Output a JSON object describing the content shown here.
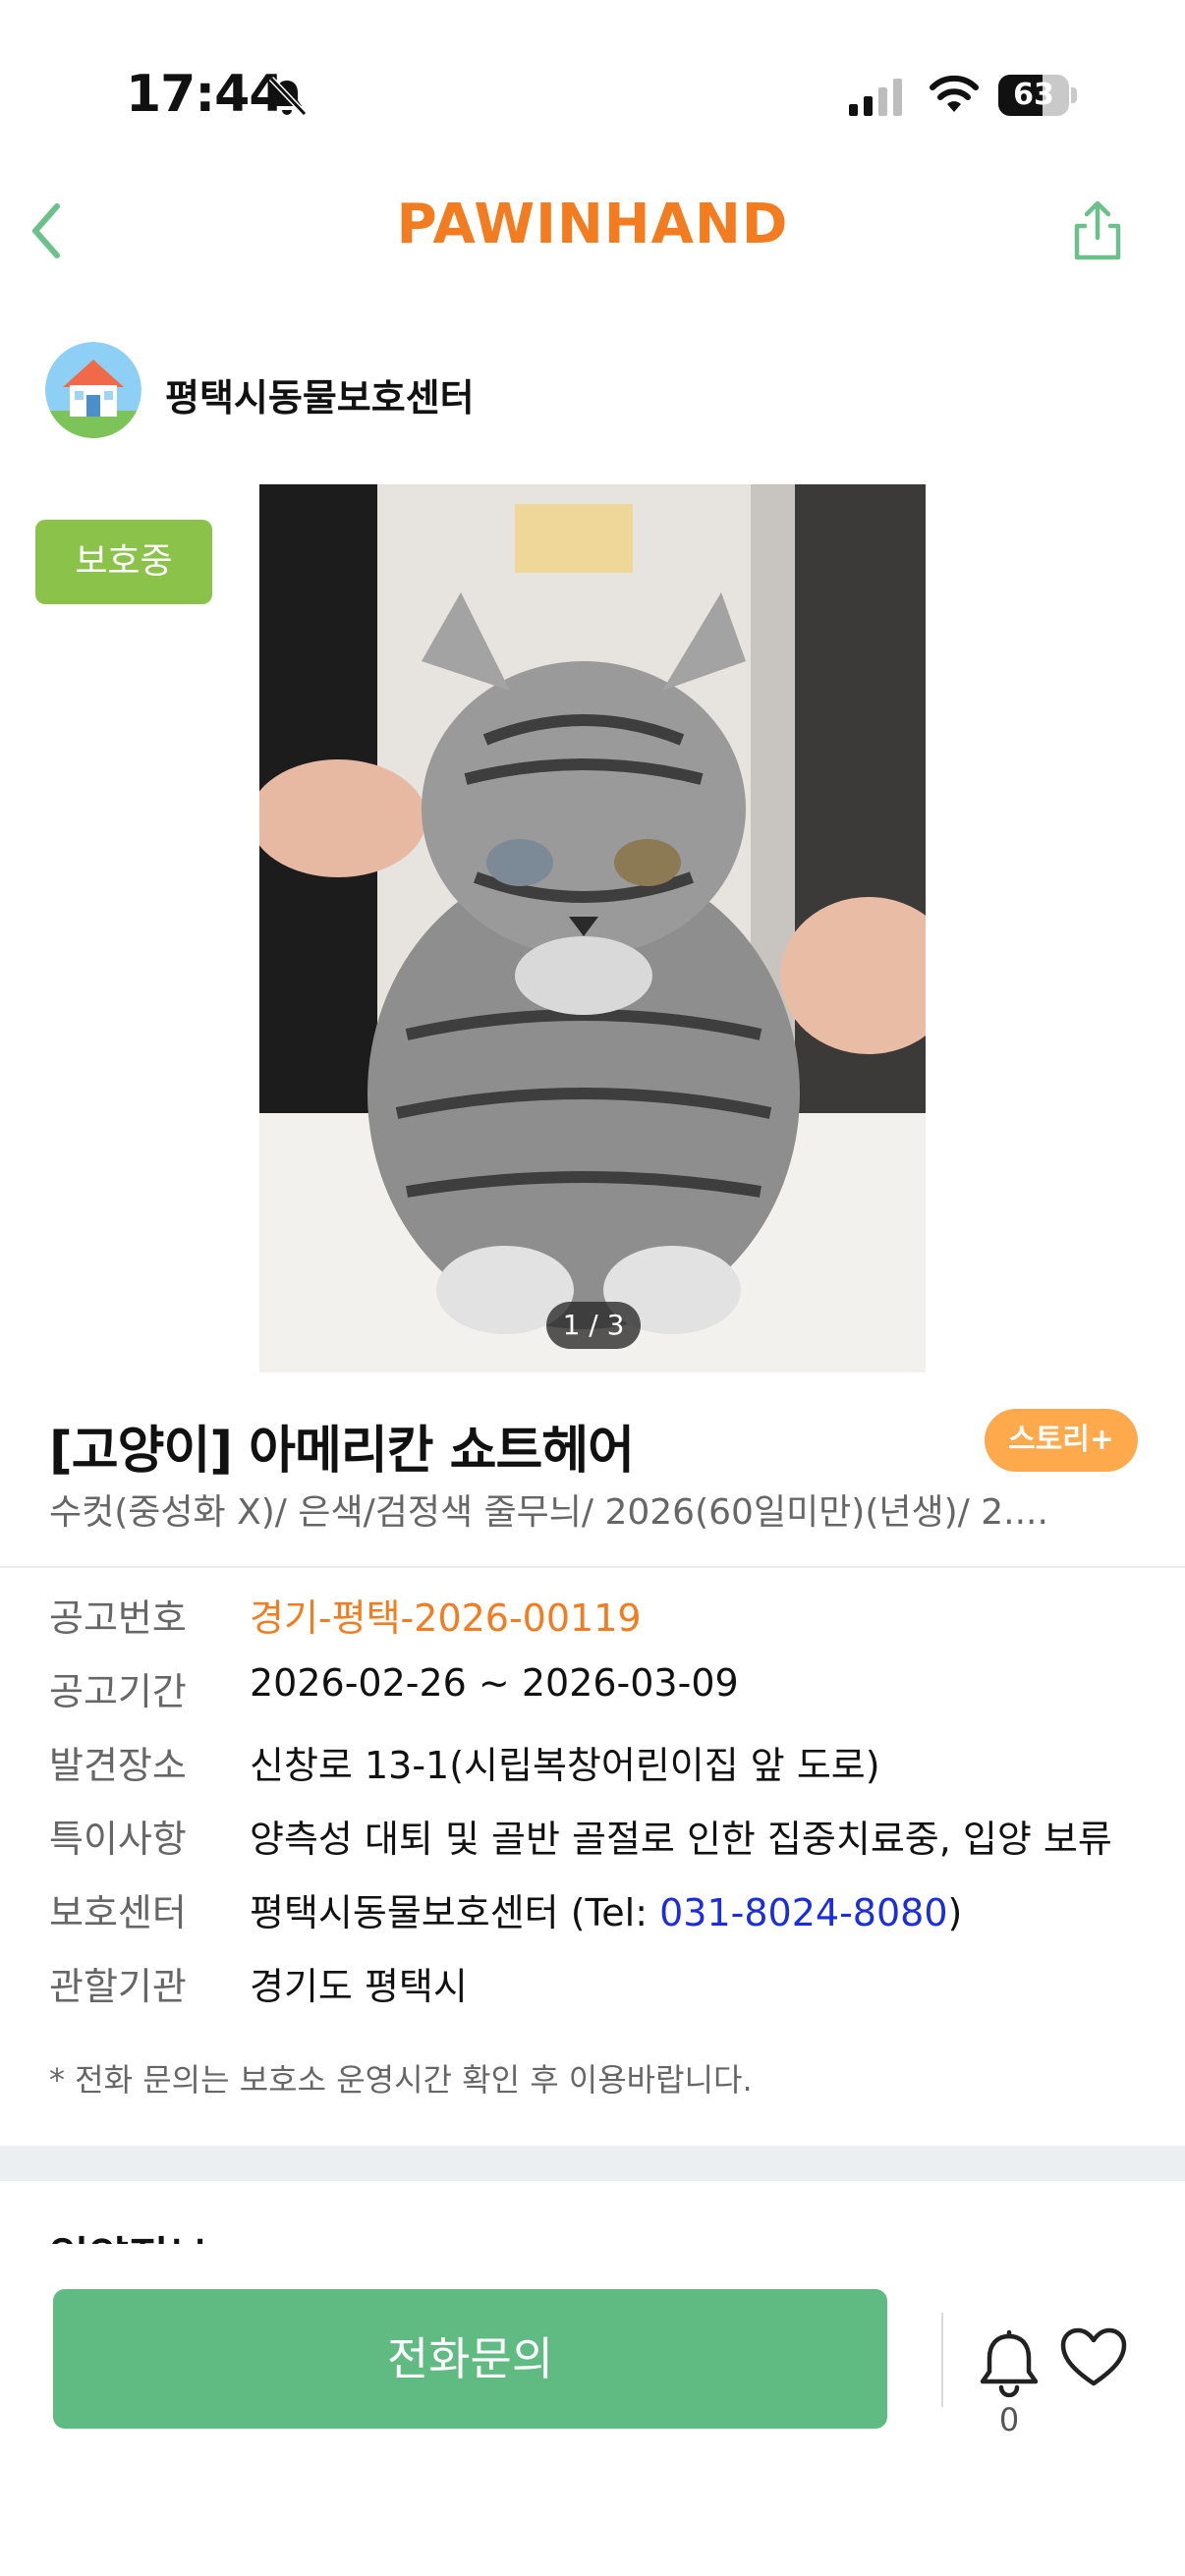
{
  "status_bar": {
    "time": "17:44",
    "battery": "63",
    "battery_level": 0.63,
    "icons": [
      "bell-slash-icon",
      "signal-icon",
      "wifi-icon",
      "battery-icon"
    ]
  },
  "header": {
    "logo": "PAWINHAND",
    "back_icon": "chevron-left-icon",
    "share_icon": "share-icon",
    "accent_color": "#f47c20",
    "icon_color": "#6cc08a"
  },
  "shelter": {
    "name": "평택시동물보호센터",
    "avatar_icon": "house-icon"
  },
  "photo": {
    "status_badge": "보호중",
    "counter": "1 / 3"
  },
  "pet": {
    "title": "[고양이] 아메리칸 쇼트헤어",
    "story_button": "스토리+",
    "subtitle": "수컷(중성화 X)/ 은색/검정색 줄무늬/ 2026(60일미만)(년생)/ 2...."
  },
  "info": {
    "notice_no_label": "공고번호",
    "notice_no_value": "경기-평택-2026-00119",
    "period_label": "공고기간",
    "period_value": "2026-02-26 ~ 2026-03-09",
    "found_place_label": "발견장소",
    "found_place_value": "신창로 13-1(시립복창어린이집 앞 도로)",
    "special_label": "특이사항",
    "special_value": "양측성 대퇴 및 골반 골절로 인한 집중치료중, 입양 보류",
    "center_label": "보호센터",
    "center_value_prefix": "평택시동물보호센터 (Tel: ",
    "center_phone": "031-8024-8080",
    "center_value_suffix": ")",
    "authority_label": "관할기관",
    "authority_value": "경기도 평택시",
    "phone_notice": "* 전화 문의는 보호소 운영시간 확인 후 이용바랍니다."
  },
  "next_section_peek": "입양정보",
  "bottom_bar": {
    "call_button": "전화문의",
    "alarm_count": "0",
    "alarm_icon": "bell-icon",
    "like_icon": "heart-icon",
    "button_color": "#60bb82"
  }
}
